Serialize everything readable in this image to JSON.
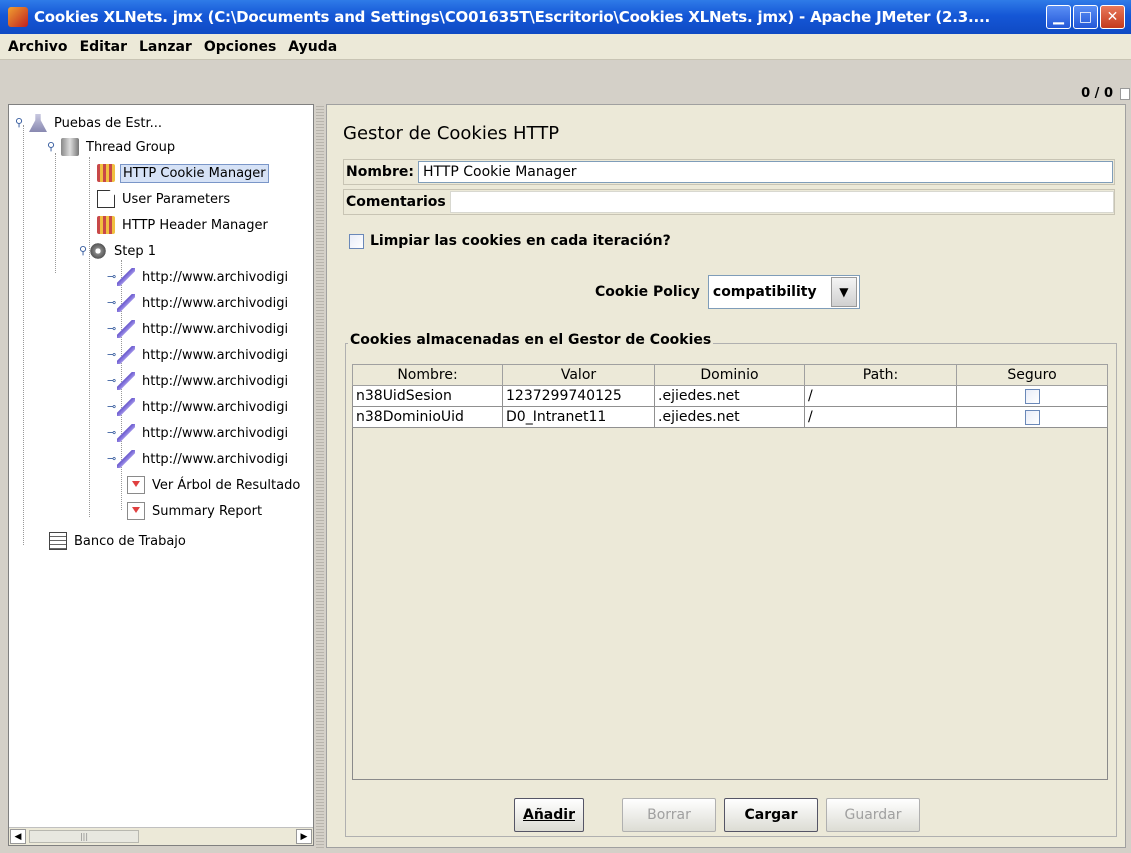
{
  "window": {
    "title": "Cookies XLNets. jmx (C:\\Documents and Settings\\CO01635T\\Escritorio\\Cookies XLNets. jmx) - Apache JMeter (2.3....",
    "min_glyph": "▁",
    "max_glyph": "□",
    "close_glyph": "✕"
  },
  "menu": [
    "Archivo",
    "Editar",
    "Lanzar",
    "Opciones",
    "Ayuda"
  ],
  "status": {
    "counter": "0 / 0"
  },
  "tree": {
    "root": "Puebas de Estr...",
    "thread_group": "Thread Group",
    "cookie_manager": "HTTP Cookie Manager",
    "user_parameters": "User Parameters",
    "header_manager": "HTTP Header Manager",
    "step": "Step 1",
    "samplers": [
      "http://www.archivodigi",
      "http://www.archivodigi",
      "http://www.archivodigi",
      "http://www.archivodigi",
      "http://www.archivodigi",
      "http://www.archivodigi",
      "http://www.archivodigi",
      "http://www.archivodigi"
    ],
    "result_tree": "Ver Árbol de Resultado",
    "summary": "Summary Report",
    "workbench": "Banco de Trabajo",
    "scroll_thumb": "|||"
  },
  "panel": {
    "title": "Gestor de Cookies HTTP",
    "name_label": "Nombre:",
    "name_value": "HTTP Cookie Manager",
    "comments_label": "Comentarios",
    "clear_label": "Limpiar las cookies en cada iteración?",
    "policy_label": "Cookie Policy",
    "policy_value": "compatibility",
    "group_title": "Cookies almacenadas en el Gestor de Cookies",
    "columns": [
      "Nombre:",
      "Valor",
      "Dominio",
      "Path:",
      "Seguro"
    ],
    "rows": [
      [
        "n38UidSesion",
        "1237299740125",
        ".ejiedes.net",
        "/"
      ],
      [
        "n38DominioUid",
        "D0_Intranet11",
        ".ejiedes.net",
        "/"
      ]
    ],
    "buttons": {
      "add": "Añadir",
      "delete": "Borrar",
      "load": "Cargar",
      "save": "Guardar"
    }
  }
}
